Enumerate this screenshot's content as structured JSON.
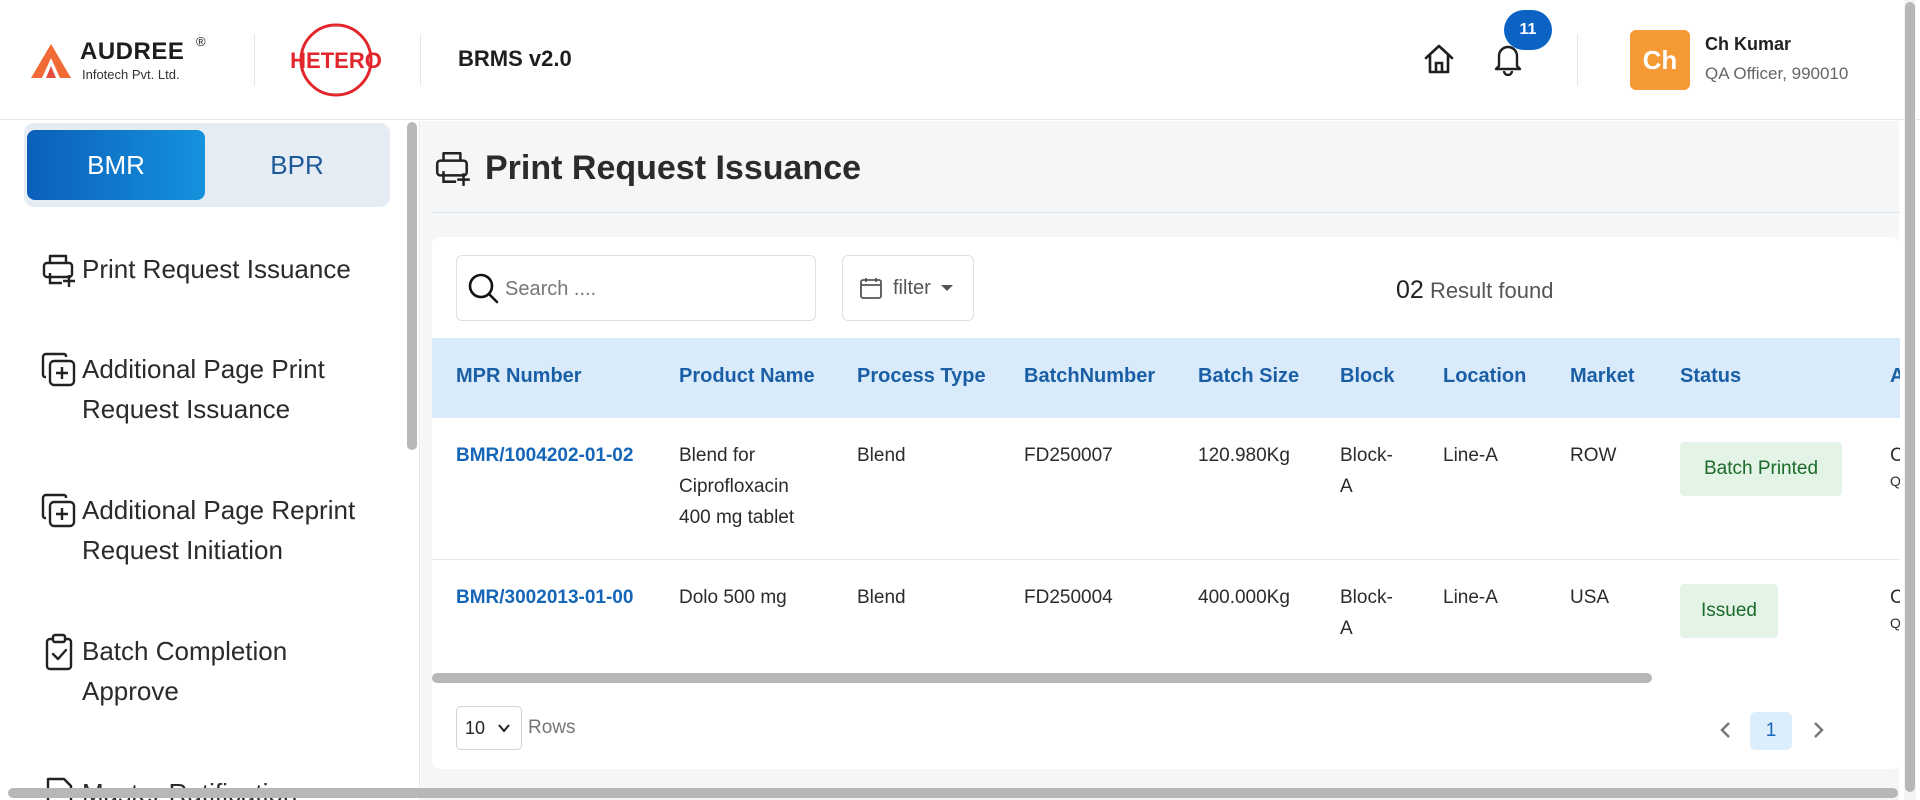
{
  "brand": {
    "company_name": "AUDREE",
    "company_registered": "®",
    "company_subtitle": "Infotech Pvt. Ltd.",
    "client_logo_text": "HETERO",
    "app_title": "BRMS v2.0"
  },
  "header": {
    "notification_count": "11",
    "avatar_initials": "Ch",
    "user_name": "Ch Kumar",
    "user_role": "QA Officer, 990010",
    "avatar_color": "#f59a35",
    "badge_color": "#0c63c4"
  },
  "sidebar": {
    "tabs": [
      {
        "label": "BMR",
        "active": true
      },
      {
        "label": "BPR",
        "active": false
      }
    ],
    "items": [
      {
        "label": "Print Request Issuance",
        "icon": "printer-plus-icon"
      },
      {
        "label": "Additional Page Print Request Issuance",
        "icon": "copy-plus-icon"
      },
      {
        "label": "Additional Page Reprint Request Initiation",
        "icon": "copy-plus-icon"
      },
      {
        "label": "Batch Completion Approve",
        "icon": "clipboard-check-icon"
      },
      {
        "label": "Master Ratification",
        "icon": "document-icon"
      }
    ]
  },
  "main": {
    "page_title": "Print Request Issuance",
    "page_icon": "printer-plus-icon",
    "search_placeholder": "Search ....",
    "filter_label": "filter",
    "result_count": "02",
    "result_label": "Result found",
    "columns": [
      "MPR Number",
      "Product Name",
      "Process Type",
      "BatchNumber",
      "Batch Size",
      "Block",
      "Location",
      "Market",
      "Status",
      "Ac"
    ],
    "rows": [
      {
        "mpr_number": "BMR/1004202-01-02",
        "product_name_lines": [
          "Blend for",
          "Ciprofloxacin",
          "400 mg tablet"
        ],
        "process_type": "Blend",
        "batch_number": "FD250007",
        "batch_size": "120.980Kg",
        "block_lines": [
          "Block-",
          "A"
        ],
        "location": "Line-A",
        "market": "ROW",
        "status": "Batch Printed",
        "action_lines": [
          "Ch",
          "QA"
        ]
      },
      {
        "mpr_number": "BMR/3002013-01-00",
        "product_name_lines": [
          "Dolo 500 mg"
        ],
        "process_type": "Blend",
        "batch_number": "FD250004",
        "batch_size": "400.000Kg",
        "block_lines": [
          "Block-",
          "A"
        ],
        "location": "Line-A",
        "market": "USA",
        "status": "Issued",
        "action_lines": [
          "Ch",
          "QA"
        ]
      }
    ],
    "rows_per_page": "10",
    "rows_label": "Rows",
    "current_page": "1"
  },
  "colors": {
    "accent": "#1565b8",
    "header_row": "#d9ebfa",
    "status_bg": "#e3f3e5",
    "status_text": "#1b6a2a"
  }
}
